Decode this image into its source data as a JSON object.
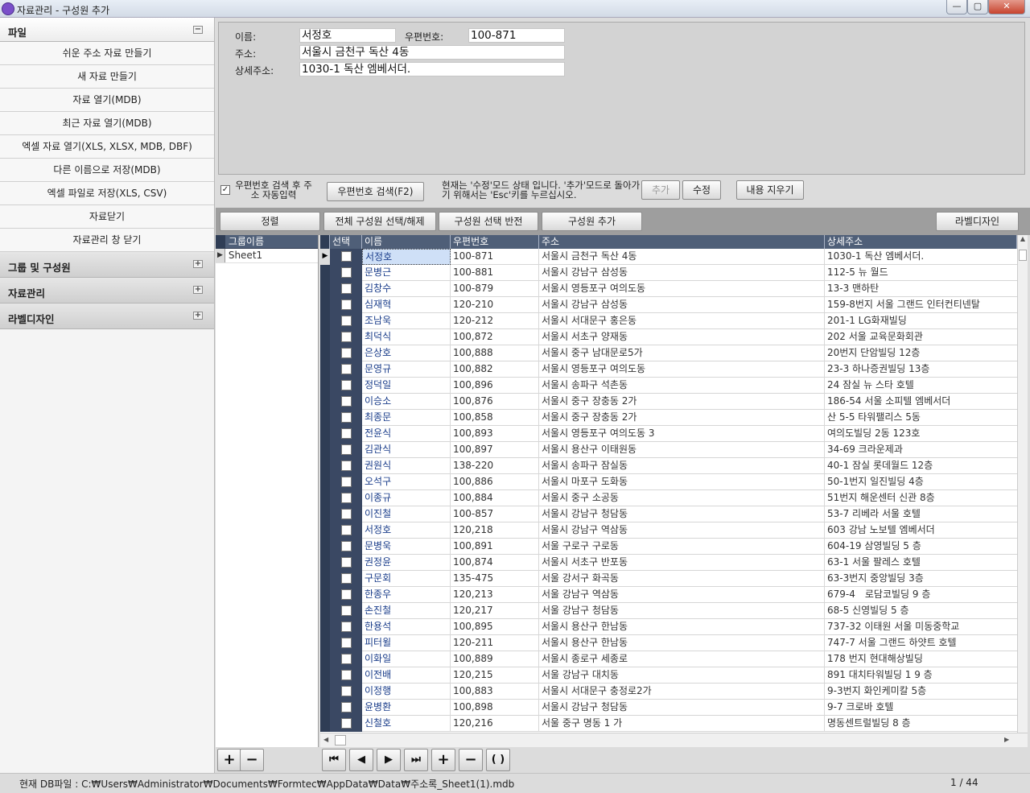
{
  "window": {
    "title": "자료관리 - 구성원 추가",
    "min": "—",
    "max": "▢",
    "close": "✕"
  },
  "sidebar": {
    "file_header": "파일",
    "file_items": [
      "쉬운 주소 자료 만들기",
      "새 자료 만들기",
      "자료 열기(MDB)",
      "최근 자료 열기(MDB)",
      "엑셀 자료 열기(XLS, XLSX, MDB, DBF)",
      "다른 이름으로 저장(MDB)",
      "엑셀 파일로 저장(XLS, CSV)",
      "자료닫기",
      "자료관리 창 닫기"
    ],
    "group_header": "그룹 및 구성원",
    "data_header": "자료관리",
    "label_header": "라벨디자인",
    "collapse_glyph": "−",
    "expand_glyph": "+"
  },
  "form": {
    "name_label": "이름:",
    "name_value": "서정호",
    "zip_label": "우편번호:",
    "zip_value": "100-871",
    "addr_label": "주소:",
    "addr_value": "서울시 금천구 독산 4동",
    "detail_label": "상세주소:",
    "detail_value": "1030-1 독산 엠베서더."
  },
  "toolbar": {
    "auto_check_glyph": "✓",
    "auto_label": "우편번호 검색 후 주소 자동입력",
    "zip_search": "우편번호 검색(F2)",
    "status": "현재는 '수정'모드 상태 입니다. '추가'모드로 돌아가기 위해서는 'Esc'키를 누르십시오.",
    "add": "추가",
    "edit": "수정",
    "clear": "내용 지우기",
    "sort": "정렬",
    "select_all": "전체 구성원 선택/해제",
    "invert": "구성원 선택 반전",
    "add_member": "구성원 추가",
    "label_design": "라벨디자인"
  },
  "group_grid": {
    "header": "그룹이름",
    "rows": [
      "Sheet1"
    ]
  },
  "grid": {
    "headers": {
      "select": "선택",
      "name": "이름",
      "zip": "우편번호",
      "addr": "주소",
      "detail": "상세주소"
    },
    "rows": [
      {
        "name": "서정호",
        "zip": "100-871",
        "addr": "서울시 금천구 독산 4동",
        "detail": "1030-1 독산 엠베서더."
      },
      {
        "name": "문병근",
        "zip": "100-881",
        "addr": "서울시 강남구 삼성동",
        "detail": "112-5 뉴 월드"
      },
      {
        "name": "김창수",
        "zip": "100-879",
        "addr": "서울시 영등포구 여의도동",
        "detail": "13-3 맨하탄"
      },
      {
        "name": "심재혁",
        "zip": "120-210",
        "addr": "서울시 강남구 삼성동",
        "detail": "159-8번지 서울 그랜드 인터컨티넨탈"
      },
      {
        "name": "조남욱",
        "zip": "120-212",
        "addr": "서울시 서대문구 홍은동",
        "detail": "201-1 LG화재빌딩"
      },
      {
        "name": "최덕식",
        "zip": "100,872",
        "addr": "서울시 서초구 양재동",
        "detail": "202 서울 교육문화회관"
      },
      {
        "name": "은상호",
        "zip": "100,888",
        "addr": "서울시 중구 남대문로5가",
        "detail": "20번지 단암빌딩 12층"
      },
      {
        "name": "문영규",
        "zip": "100,882",
        "addr": "서울시 영등포구 여의도동",
        "detail": "23-3 하나증권빌딩 13층"
      },
      {
        "name": "정덕일",
        "zip": "100,896",
        "addr": "서울시 송파구 석촌동",
        "detail": "24 잠실 뉴 스타 호텔"
      },
      {
        "name": "이승소",
        "zip": "100,876",
        "addr": "서울시 중구 장충동 2가",
        "detail": "186-54 서울 소피텔 엠베서더"
      },
      {
        "name": "최종문",
        "zip": "100,858",
        "addr": "서울시 중구 장충동 2가",
        "detail": "산 5-5 타워팰리스 5동"
      },
      {
        "name": "전윤식",
        "zip": "100,893",
        "addr": "서울시 영등포구 여의도동 3",
        "detail": "여의도빌딩 2동 123호"
      },
      {
        "name": "김관식",
        "zip": "100,897",
        "addr": "서울시 용산구 이태원동",
        "detail": "34-69 크라운제과"
      },
      {
        "name": "권원식",
        "zip": "138-220",
        "addr": "서울시 송파구 잠실동",
        "detail": "40-1 잠실 롯데월드 12층"
      },
      {
        "name": "오석구",
        "zip": "100,886",
        "addr": "서울시 마포구 도화동",
        "detail": "50-1번지 일진빌딩 4층"
      },
      {
        "name": "이종규",
        "zip": "100,884",
        "addr": "서울시 중구 소공동",
        "detail": "51번지 해운센터 신관 8층"
      },
      {
        "name": "이진철",
        "zip": "100-857",
        "addr": "서울시 강남구 청담동",
        "detail": "53-7 리베라 서울 호텔"
      },
      {
        "name": "서정호",
        "zip": "120,218",
        "addr": "서울시 강남구 역삼동",
        "detail": "603 강남 노보텔 엠베서더"
      },
      {
        "name": "문병욱",
        "zip": "100,891",
        "addr": "서울 구로구 구로동",
        "detail": "604-19 삼영빌딩 5 층"
      },
      {
        "name": "권정윤",
        "zip": "100,874",
        "addr": "서울시 서초구 반포동",
        "detail": "63-1 서울 팔레스 호텔"
      },
      {
        "name": "구문회",
        "zip": "135-475",
        "addr": "서울 강서구 화곡동",
        "detail": "63-3번지 중앙빌딩 3층"
      },
      {
        "name": "한종우",
        "zip": "120,213",
        "addr": "서울 강남구 역삼동",
        "detail": "679-4　로담코빌딩 9 층"
      },
      {
        "name": "손진철",
        "zip": "120,217",
        "addr": "서울 강남구 청담동",
        "detail": "68-5 신영빌딩 5 층"
      },
      {
        "name": "한용석",
        "zip": "100,895",
        "addr": "서울시 용산구 한남동",
        "detail": "737-32 이태원 서울 미동중학교"
      },
      {
        "name": "피터윌",
        "zip": "120-211",
        "addr": "서울시 용산구 한남동",
        "detail": "747-7 서울 그랜드 하얏트 호텔"
      },
      {
        "name": "이화일",
        "zip": "100,889",
        "addr": "서울시 종로구 세종로",
        "detail": "178 번지 현대해상빌딩"
      },
      {
        "name": "이전배",
        "zip": "120,215",
        "addr": "서울 강남구 대치동",
        "detail": "891 대치타워빌딩 1 9 층"
      },
      {
        "name": "이정행",
        "zip": "100,883",
        "addr": "서울시 서대문구 충정로2가",
        "detail": "9-3번지 화인케미칼 5층"
      },
      {
        "name": "윤병환",
        "zip": "100,898",
        "addr": "서울시 강남구 청담동",
        "detail": "9-7 크로바 호텔"
      },
      {
        "name": "신철호",
        "zip": "120,216",
        "addr": "서울 중구 명동 1 가",
        "detail": "명동센트럴빌딩 8 층"
      }
    ]
  },
  "nav": {
    "add": "+",
    "remove": "−",
    "first": "⏮",
    "prev": "◀",
    "play": "▶",
    "last": "⏭",
    "refresh": "( )"
  },
  "statusbar": {
    "db_file": "현재 DB파일 : C:₩Users₩Administrator₩Documents₩Formtec₩AppData₩Data₩주소록_Sheet1(1).mdb",
    "page": "1 / 44"
  }
}
